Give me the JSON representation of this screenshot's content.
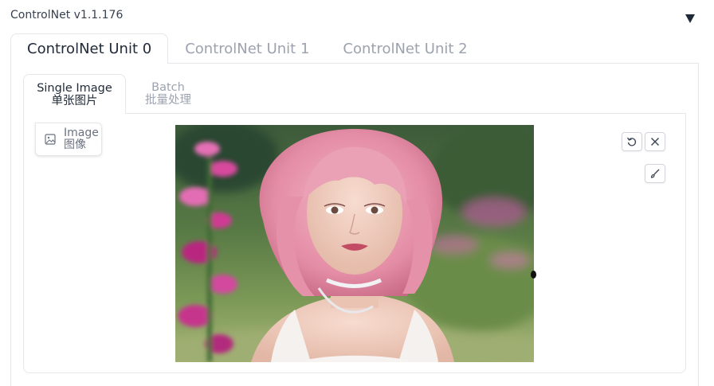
{
  "panel": {
    "title": "ControlNet v1.1.176",
    "collapse_icon": "triangle-down-icon"
  },
  "unit_tabs": [
    {
      "label": "ControlNet Unit 0",
      "active": true
    },
    {
      "label": "ControlNet Unit 1",
      "active": false
    },
    {
      "label": "ControlNet Unit 2",
      "active": false
    }
  ],
  "mode_tabs": [
    {
      "label_en": "Single Image",
      "label_zh": "单张图片",
      "active": true
    },
    {
      "label_en": "Batch",
      "label_zh": "批量处理",
      "active": false
    }
  ],
  "image_input": {
    "label_en": "Image",
    "label_zh": "图像",
    "icon": "image-icon",
    "preview": "portrait of a young woman with pink bob hair, white choker and white top, pink flowers in foreground, green blurred meadow background"
  },
  "toolbar": {
    "undo_icon": "undo-icon",
    "clear_icon": "close-icon",
    "brush_icon": "brush-icon"
  },
  "colors": {
    "border": "#e5e7eb",
    "muted_text": "#9ca3af",
    "text": "#1f2937"
  }
}
